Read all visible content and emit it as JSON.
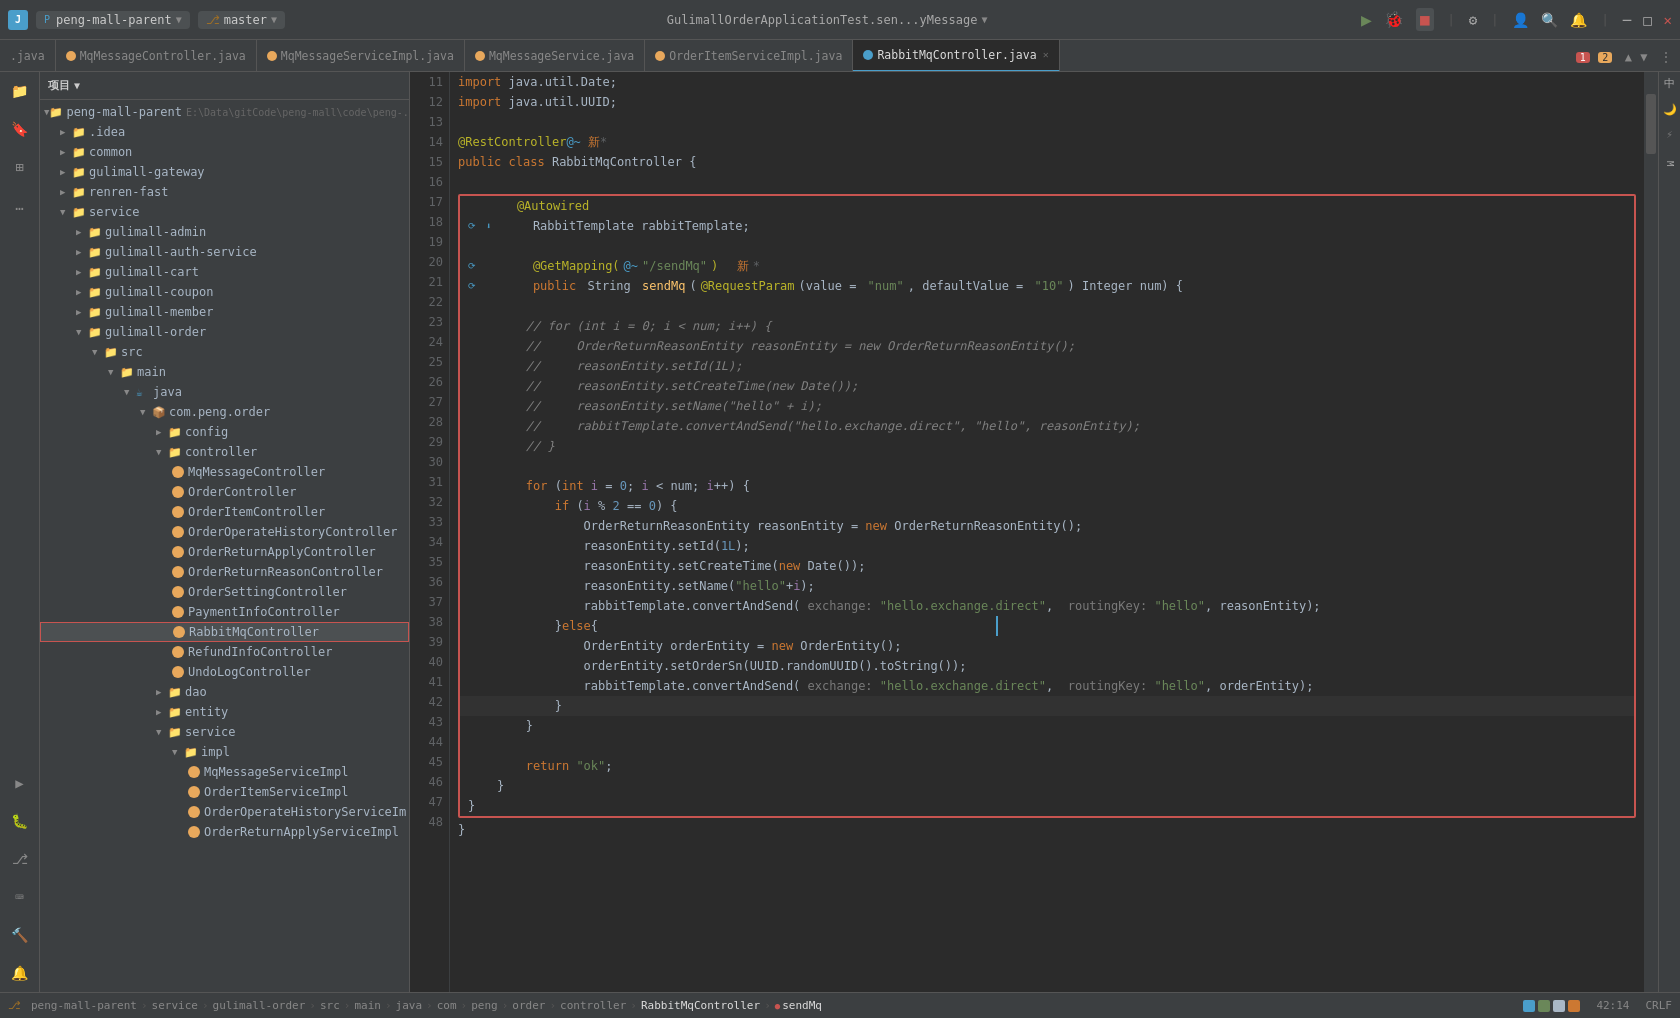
{
  "titlebar": {
    "logo": "J",
    "project": "peng-mall-parent",
    "branch": "master",
    "center_text": "GulimallOrderApplicationTest.sen...yMessage",
    "run_icon": "▶",
    "debug_icon": "🐛",
    "stop_icon": "■"
  },
  "tabs": [
    {
      "label": ".java",
      "type": "other",
      "active": false
    },
    {
      "label": "MqMessageController.java",
      "type": "orange",
      "active": false
    },
    {
      "label": "MqMessageServiceImpl.java",
      "type": "orange",
      "active": false
    },
    {
      "label": "MqMessageService.java",
      "type": "orange",
      "active": false
    },
    {
      "label": "OrderItemServiceImpl.java",
      "type": "orange",
      "active": false
    },
    {
      "label": "RabbitMqController.java",
      "type": "blue",
      "active": true,
      "closeable": true
    }
  ],
  "file_tree": {
    "root": "peng-mall-parent",
    "items": [
      {
        "label": "peng-mall-parent",
        "indent": 0,
        "type": "folder",
        "open": true
      },
      {
        "label": ".idea",
        "indent": 1,
        "type": "folder",
        "open": false
      },
      {
        "label": "common",
        "indent": 1,
        "type": "folder",
        "open": false
      },
      {
        "label": "gulimall-gateway",
        "indent": 1,
        "type": "folder",
        "open": false
      },
      {
        "label": "renren-fast",
        "indent": 1,
        "type": "folder",
        "open": false
      },
      {
        "label": "service",
        "indent": 1,
        "type": "folder",
        "open": true
      },
      {
        "label": "gulimall-admin",
        "indent": 2,
        "type": "folder",
        "open": false
      },
      {
        "label": "gulimall-auth-service",
        "indent": 2,
        "type": "folder",
        "open": false
      },
      {
        "label": "gulimall-cart",
        "indent": 2,
        "type": "folder",
        "open": false
      },
      {
        "label": "gulimall-coupon",
        "indent": 2,
        "type": "folder",
        "open": false
      },
      {
        "label": "gulimall-member",
        "indent": 2,
        "type": "folder",
        "open": false
      },
      {
        "label": "gulimall-order",
        "indent": 2,
        "type": "folder",
        "open": true
      },
      {
        "label": "src",
        "indent": 3,
        "type": "folder",
        "open": true
      },
      {
        "label": "main",
        "indent": 4,
        "type": "folder",
        "open": true
      },
      {
        "label": "java",
        "indent": 5,
        "type": "folder",
        "open": true
      },
      {
        "label": "com.peng.order",
        "indent": 6,
        "type": "folder",
        "open": true
      },
      {
        "label": "config",
        "indent": 7,
        "type": "folder",
        "open": false
      },
      {
        "label": "controller",
        "indent": 7,
        "type": "folder",
        "open": true
      },
      {
        "label": "MqMessageController",
        "indent": 8,
        "type": "file",
        "circle": "orange"
      },
      {
        "label": "OrderController",
        "indent": 8,
        "type": "file",
        "circle": "orange"
      },
      {
        "label": "OrderItemController",
        "indent": 8,
        "type": "file",
        "circle": "orange"
      },
      {
        "label": "OrderOperateHistoryController",
        "indent": 8,
        "type": "file",
        "circle": "orange"
      },
      {
        "label": "OrderReturnApplyController",
        "indent": 8,
        "type": "file",
        "circle": "orange"
      },
      {
        "label": "OrderReturnReasonController",
        "indent": 8,
        "type": "file",
        "circle": "orange"
      },
      {
        "label": "OrderSettingController",
        "indent": 8,
        "type": "file",
        "circle": "orange"
      },
      {
        "label": "PaymentInfoController",
        "indent": 8,
        "type": "file",
        "circle": "orange"
      },
      {
        "label": "RabbitMqController",
        "indent": 8,
        "type": "file",
        "circle": "orange",
        "highlighted": true
      },
      {
        "label": "RefundInfoController",
        "indent": 8,
        "type": "file",
        "circle": "orange"
      },
      {
        "label": "UndoLogController",
        "indent": 8,
        "type": "file",
        "circle": "orange"
      },
      {
        "label": "dao",
        "indent": 7,
        "type": "folder",
        "open": false
      },
      {
        "label": "entity",
        "indent": 7,
        "type": "folder",
        "open": false
      },
      {
        "label": "service",
        "indent": 7,
        "type": "folder",
        "open": true
      },
      {
        "label": "impl",
        "indent": 8,
        "type": "folder",
        "open": true
      },
      {
        "label": "MqMessageServiceImpl",
        "indent": 9,
        "type": "file",
        "circle": "orange"
      },
      {
        "label": "OrderItemServiceImpl",
        "indent": 9,
        "type": "file",
        "circle": "orange"
      },
      {
        "label": "OrderOperateHistoryServiceIm",
        "indent": 9,
        "type": "file",
        "circle": "orange"
      },
      {
        "label": "OrderReturnApplyServiceImpl",
        "indent": 9,
        "type": "file",
        "circle": "orange"
      }
    ]
  },
  "code": {
    "lines": [
      {
        "num": 11,
        "text": "import java.util.Date;"
      },
      {
        "num": 12,
        "text": "import java.util.UUID;"
      },
      {
        "num": 13,
        "text": ""
      },
      {
        "num": 14,
        "text": "@RestController@~ 新 *"
      },
      {
        "num": 15,
        "text": "public class RabbitMqController {"
      },
      {
        "num": 16,
        "text": ""
      },
      {
        "num": 17,
        "text": "    @Autowired",
        "highlight": true
      },
      {
        "num": 18,
        "text": "    RabbitTemplate rabbitTemplate;",
        "highlight": true
      },
      {
        "num": 19,
        "text": "",
        "highlight": true
      },
      {
        "num": 20,
        "text": "    @GetMapping(@~\"/sendMq\")  新 *",
        "highlight": true
      },
      {
        "num": 21,
        "text": "    public String sendMq(@RequestParam(value = \"num\", defaultValue = \"10\") Integer num) {",
        "highlight": true
      },
      {
        "num": 22,
        "text": "",
        "highlight": true
      },
      {
        "num": 23,
        "text": "        // for (int i = 0; i < num; i++) {",
        "highlight": true
      },
      {
        "num": 24,
        "text": "        //     OrderReturnReasonEntity reasonEntity = new OrderReturnReasonEntity();",
        "highlight": true
      },
      {
        "num": 25,
        "text": "        //     reasonEntity.setId(1L);",
        "highlight": true
      },
      {
        "num": 26,
        "text": "        //     reasonEntity.setCreateTime(new Date());",
        "highlight": true
      },
      {
        "num": 27,
        "text": "        //     reasonEntity.setName(\"hello\" + i);",
        "highlight": true
      },
      {
        "num": 28,
        "text": "        //     rabbitTemplate.convertAndSend(\"hello.exchange.direct\", \"hello\", reasonEntity);",
        "highlight": true
      },
      {
        "num": 29,
        "text": "        // }",
        "highlight": true
      },
      {
        "num": 30,
        "text": "",
        "highlight": true
      },
      {
        "num": 31,
        "text": "        for (int i = 0; i < num; i++) {",
        "highlight": true
      },
      {
        "num": 32,
        "text": "            if (i % 2 == 0) {",
        "highlight": true
      },
      {
        "num": 33,
        "text": "                OrderReturnReasonEntity reasonEntity = new OrderReturnReasonEntity();",
        "highlight": true
      },
      {
        "num": 34,
        "text": "                reasonEntity.setId(1L);",
        "highlight": true
      },
      {
        "num": 35,
        "text": "                reasonEntity.setCreateTime(new Date());",
        "highlight": true
      },
      {
        "num": 36,
        "text": "                reasonEntity.setName(\"hello\"+i);",
        "highlight": true
      },
      {
        "num": 37,
        "text": "                rabbitTemplate.convertAndSend( exchange: \"hello.exchange.direct\",  routingKey: \"hello\", reasonEntity);",
        "highlight": true
      },
      {
        "num": 38,
        "text": "            }else{",
        "highlight": true
      },
      {
        "num": 39,
        "text": "                OrderEntity orderEntity = new OrderEntity();",
        "highlight": true
      },
      {
        "num": 40,
        "text": "                orderEntity.setOrderSn(UUID.randomUUID().toString());",
        "highlight": true
      },
      {
        "num": 41,
        "text": "                rabbitTemplate.convertAndSend( exchange: \"hello.exchange.direct\",  routingKey: \"hello\", orderEntity);",
        "highlight": true
      },
      {
        "num": 42,
        "text": "            }",
        "highlight": true
      },
      {
        "num": 43,
        "text": "        }",
        "highlight": true
      },
      {
        "num": 44,
        "text": "",
        "highlight": true
      },
      {
        "num": 45,
        "text": "        return \"ok\";",
        "highlight": true
      },
      {
        "num": 46,
        "text": "    }",
        "highlight": true
      },
      {
        "num": 47,
        "text": "}",
        "highlight": true
      },
      {
        "num": 48,
        "text": "}"
      }
    ]
  },
  "statusbar": {
    "breadcrumbs": [
      "peng-mall-parent",
      "service",
      "gulimall-order",
      "src",
      "main",
      "java",
      "com",
      "peng",
      "order",
      "controller",
      "RabbitMqController",
      "sendMq"
    ],
    "position": "42:14",
    "encoding": "CRLF",
    "error_count": "1",
    "warn_count": "2",
    "indent": "中"
  },
  "sidebar_icons": [
    {
      "name": "project-icon",
      "symbol": "📁"
    },
    {
      "name": "bookmark-icon",
      "symbol": "🔖"
    },
    {
      "name": "structure-icon",
      "symbol": "⊞"
    },
    {
      "name": "more-icon",
      "symbol": "…"
    }
  ]
}
